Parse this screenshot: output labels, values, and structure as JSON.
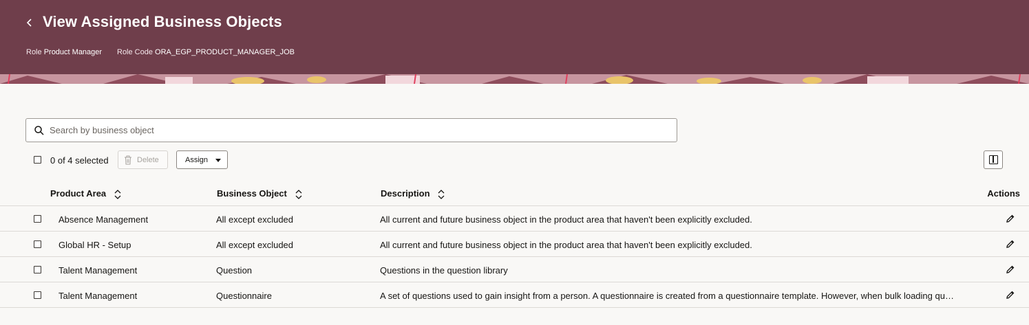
{
  "header": {
    "title": "View Assigned Business Objects",
    "role_label": "Role",
    "role_value": "Product Manager",
    "code_label": "Role Code",
    "code_value": "ORA_EGP_PRODUCT_MANAGER_JOB",
    "background_color": "#6f3e4b"
  },
  "search": {
    "placeholder": "Search by business object",
    "value": ""
  },
  "toolbar": {
    "selection_text": "0 of 4 selected",
    "delete_label": "Delete",
    "assign_label": "Assign"
  },
  "table": {
    "columns": [
      "Product Area",
      "Business Object",
      "Description",
      "Actions"
    ],
    "rows": [
      {
        "product_area": "Absence Management",
        "business_object": "All except excluded",
        "description": "All current and future business object in the product area that haven't been explicitly excluded."
      },
      {
        "product_area": "Global HR - Setup",
        "business_object": "All except excluded",
        "description": "All current and future business object in the product area that haven't been explicitly excluded."
      },
      {
        "product_area": "Talent Management",
        "business_object": "Question",
        "description": "Questions in the question library"
      },
      {
        "product_area": "Talent Management",
        "business_object": "Questionnaire",
        "description": "A set of questions used to gain insight from a person. A questionnaire is created from a questionnaire template. However, when bulk loading qu…"
      }
    ]
  },
  "icons": {
    "back": "chevron-left-icon",
    "search": "search-icon",
    "delete": "trash-icon",
    "assign": "caret-down-icon",
    "columns": "columns-icon",
    "sort": "sort-icon",
    "edit": "pencil-icon"
  }
}
